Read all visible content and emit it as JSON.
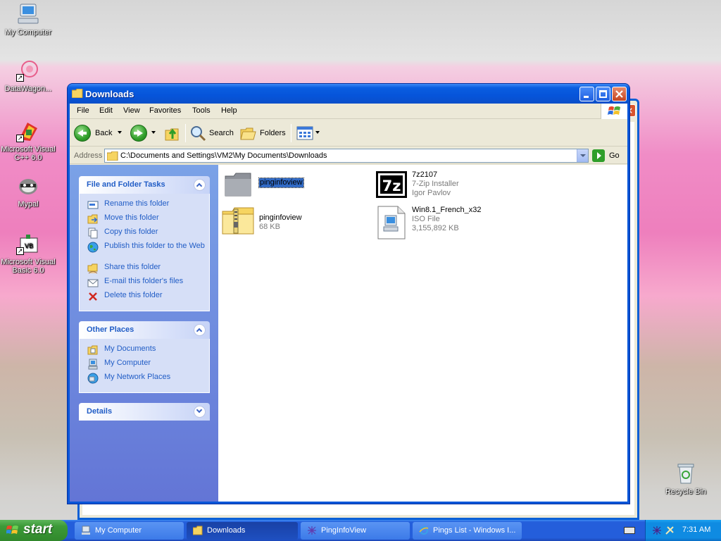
{
  "desktop": {
    "icons": [
      {
        "label": "My Computer"
      },
      {
        "label": "DataWagon..."
      },
      {
        "label": "Microsoft Visual C++ 6.0"
      },
      {
        "label": "Mypal"
      },
      {
        "label": "Microsoft Visual Basic 6.0"
      },
      {
        "label": "Recycle Bin"
      }
    ]
  },
  "window": {
    "title": "Downloads",
    "menu": [
      "File",
      "Edit",
      "View",
      "Favorites",
      "Tools",
      "Help"
    ],
    "toolbar": {
      "back": "Back",
      "search": "Search",
      "folders": "Folders"
    },
    "address": {
      "label": "Address",
      "path": "C:\\Documents and Settings\\VM2\\My Documents\\Downloads",
      "go": "Go"
    },
    "tasks_panel": {
      "title": "File and Folder Tasks",
      "items": [
        "Rename this folder",
        "Move this folder",
        "Copy this folder",
        "Publish this folder to the Web",
        "Share this folder",
        "E-mail this folder's files",
        "Delete this folder"
      ]
    },
    "places_panel": {
      "title": "Other Places",
      "items": [
        "My Documents",
        "My Computer",
        "My Network Places"
      ]
    },
    "details_panel": {
      "title": "Details"
    },
    "files": [
      {
        "name": "pinginfoview",
        "line2": "",
        "line3": ""
      },
      {
        "name": "7z2107",
        "line2": "7-Zip Installer",
        "line3": "Igor Pavlov"
      },
      {
        "name": "pinginfoview",
        "line2": "68 KB",
        "line3": ""
      },
      {
        "name": "Win8.1_French_x32",
        "line2": "ISO File",
        "line3": "3,155,892 KB"
      }
    ]
  },
  "taskbar": {
    "start": "start",
    "buttons": [
      "My Computer",
      "Downloads",
      "PingInfoView",
      "Pings List - Windows I..."
    ],
    "clock": "7:31 AM"
  },
  "colors": {
    "xp_blue": "#0a56d8",
    "task_link": "#215dc6",
    "start_green": "#3c9a38",
    "selection": "#316ac5"
  }
}
